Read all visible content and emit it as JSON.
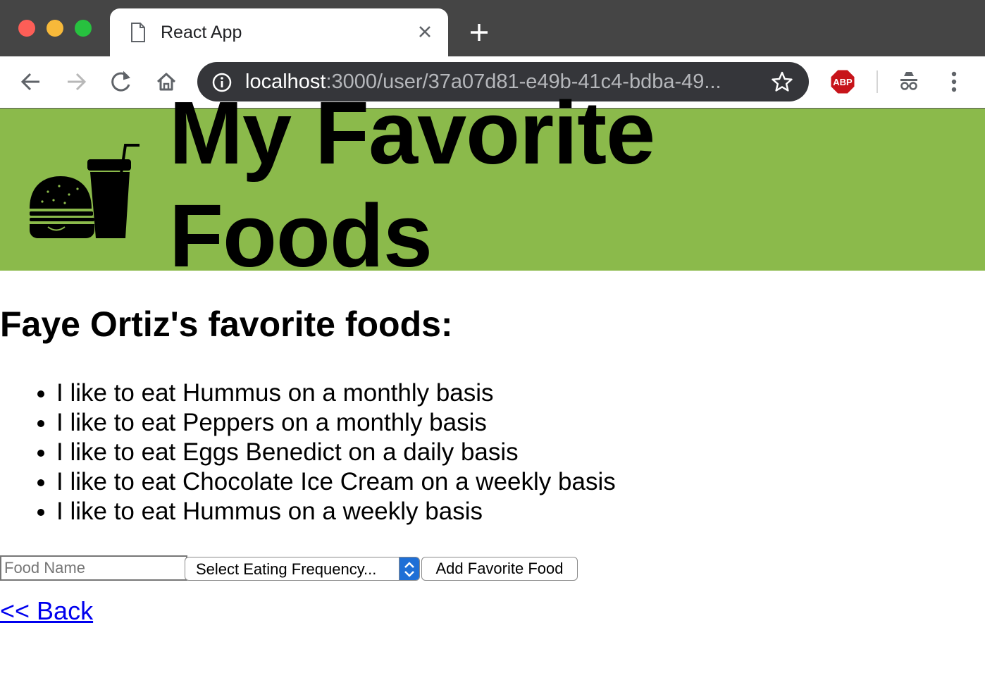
{
  "browser": {
    "tab_title": "React App",
    "url_host": "localhost",
    "url_rest": ":3000/user/37a07d81-e49b-41c4-bdba-49..."
  },
  "header": {
    "title": "My Favorite Foods"
  },
  "main": {
    "subheading": "Faye Ortiz's favorite foods:",
    "foods": [
      "I like to eat Hummus on a monthly basis",
      "I like to eat Peppers on a monthly basis",
      "I like to eat Eggs Benedict on a daily basis",
      "I like to eat Chocolate Ice Cream on a weekly basis",
      "I like to eat Hummus on a weekly basis"
    ],
    "form": {
      "food_placeholder": "Food Name",
      "frequency_selected": "Select Eating Frequency...",
      "add_button_label": "Add Favorite Food"
    },
    "back_link": "<< Back"
  },
  "colors": {
    "header_bg": "#8bba4b",
    "tab_strip_bg": "#454545",
    "omnibox_bg": "#35363a",
    "link": "#0000ee",
    "select_accent": "#1f6fd6"
  },
  "icons": [
    "document-icon",
    "close-icon",
    "new-tab-icon",
    "back-arrow-icon",
    "forward-arrow-icon",
    "reload-icon",
    "home-icon",
    "info-icon",
    "star-icon",
    "adblock-plus-icon",
    "incognito-icon",
    "more-vert-icon",
    "burger-and-drink-logo"
  ]
}
